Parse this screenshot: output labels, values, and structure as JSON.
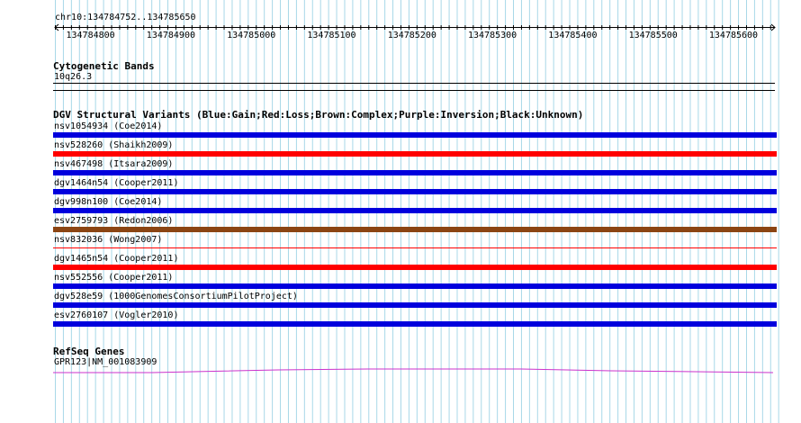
{
  "coords": "chr10:134784752..134785650",
  "ruler": {
    "ticks": [
      "134784800",
      "134784900",
      "134785000",
      "134785100",
      "134785200",
      "134785300",
      "134785400",
      "134785500",
      "134785600"
    ]
  },
  "cytoband": {
    "title": "Cytogenetic Bands",
    "band": "10q26.3"
  },
  "dgv": {
    "title": "DGV Structural Variants (Blue:Gain;Red:Loss;Brown:Complex;Purple:Inversion;Black:Unknown)",
    "variants": [
      {
        "label": "nsv1054934 (Coe2014)",
        "type": "gain",
        "color": "#0000dd"
      },
      {
        "label": "nsv528260 (Shaikh2009)",
        "type": "loss",
        "color": "#ff0000"
      },
      {
        "label": "nsv467498 (Itsara2009)",
        "type": "gain",
        "color": "#0000dd"
      },
      {
        "label": "dgv1464n54 (Cooper2011)",
        "type": "gain",
        "color": "#0000dd"
      },
      {
        "label": "dgv998n100 (Coe2014)",
        "type": "gain",
        "color": "#0000dd"
      },
      {
        "label": "esv2759793 (Redon2006)",
        "type": "complex",
        "color": "#8b4513"
      },
      {
        "label": "nsv832036 (Wong2007)",
        "type": "loss",
        "color": "#ff0000"
      },
      {
        "label": "dgv1465n54 (Cooper2011)",
        "type": "loss",
        "color": "#ff0000"
      },
      {
        "label": "nsv552556 (Cooper2011)",
        "type": "gain",
        "color": "#0000dd"
      },
      {
        "label": "dgv528e59 (1000GenomesConsortiumPilotProject)",
        "type": "gain",
        "color": "#0000dd"
      },
      {
        "label": "esv2760107 (Vogler2010)",
        "type": "gain",
        "color": "#0000dd"
      }
    ]
  },
  "refseq": {
    "title": "RefSeq Genes",
    "gene": "GPR123|NM_001083909",
    "color": "#cc33cc"
  },
  "colors": {
    "grid": "#a8d8e8",
    "gain": "#0000dd",
    "loss": "#ff0000",
    "complex": "#8b4513"
  }
}
